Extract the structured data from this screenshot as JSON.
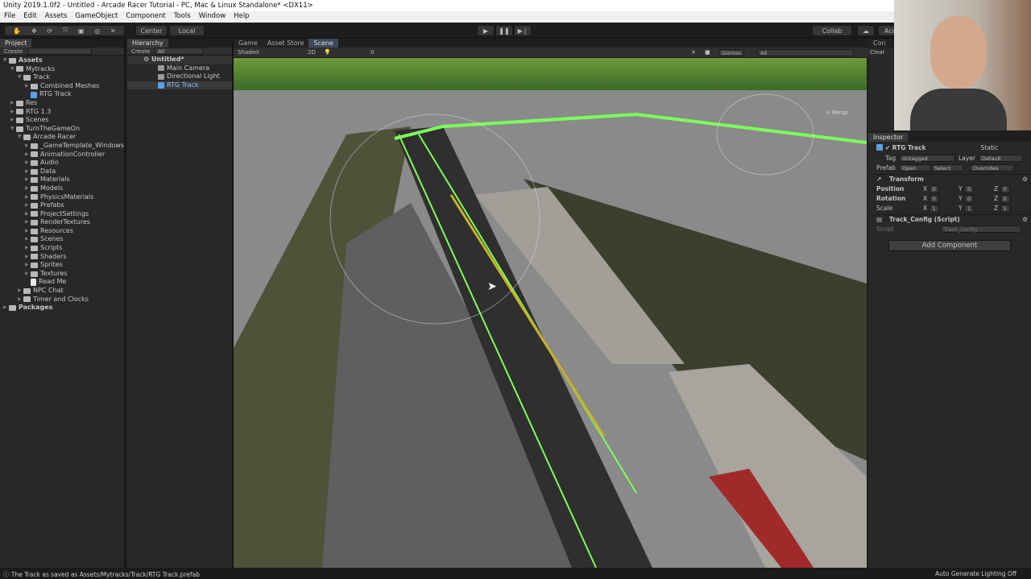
{
  "window": {
    "title": "Unity 2019.1.0f2 - Untitled - Arcade Racer Tutorial - PC, Mac & Linux Standalone* <DX11>"
  },
  "menu": [
    "File",
    "Edit",
    "Assets",
    "GameObject",
    "Component",
    "Tools",
    "Window",
    "Help"
  ],
  "toolbar": {
    "pivot": "Center",
    "space": "Local",
    "collab": "Collab",
    "account": "Acc"
  },
  "project": {
    "tab": "Project",
    "create": "Create",
    "items": [
      {
        "label": "Assets",
        "depth": 0,
        "type": "folder",
        "open": true,
        "bold": true
      },
      {
        "label": "Mytracks",
        "depth": 1,
        "type": "folder",
        "open": true
      },
      {
        "label": "Track",
        "depth": 2,
        "type": "folder",
        "open": true
      },
      {
        "label": "Combined Meshes",
        "depth": 3,
        "type": "folder",
        "open": false
      },
      {
        "label": "RTG Track",
        "depth": 3,
        "type": "prefab"
      },
      {
        "label": "Res",
        "depth": 1,
        "type": "folder",
        "open": false
      },
      {
        "label": "RTG 1.3",
        "depth": 1,
        "type": "folder",
        "open": false
      },
      {
        "label": "Scenes",
        "depth": 1,
        "type": "folder",
        "open": false
      },
      {
        "label": "TurnTheGameOn",
        "depth": 1,
        "type": "folder",
        "open": true
      },
      {
        "label": "Arcade Racer",
        "depth": 2,
        "type": "folder",
        "open": true
      },
      {
        "label": "_GameTemplate_Windows",
        "depth": 3,
        "type": "folder",
        "open": false
      },
      {
        "label": "AnimationController",
        "depth": 3,
        "type": "folder",
        "open": false
      },
      {
        "label": "Audio",
        "depth": 3,
        "type": "folder",
        "open": false
      },
      {
        "label": "Data",
        "depth": 3,
        "type": "folder",
        "open": false
      },
      {
        "label": "Materials",
        "depth": 3,
        "type": "folder",
        "open": false
      },
      {
        "label": "Models",
        "depth": 3,
        "type": "folder",
        "open": false
      },
      {
        "label": "PhysicsMaterials",
        "depth": 3,
        "type": "folder",
        "open": false
      },
      {
        "label": "Prefabs",
        "depth": 3,
        "type": "folder",
        "open": false
      },
      {
        "label": "ProjectSettings",
        "depth": 3,
        "type": "folder",
        "open": false
      },
      {
        "label": "RenderTextures",
        "depth": 3,
        "type": "folder",
        "open": false
      },
      {
        "label": "Resources",
        "depth": 3,
        "type": "folder",
        "open": false
      },
      {
        "label": "Scenes",
        "depth": 3,
        "type": "folder",
        "open": false
      },
      {
        "label": "Scripts",
        "depth": 3,
        "type": "folder",
        "open": false
      },
      {
        "label": "Shaders",
        "depth": 3,
        "type": "folder",
        "open": false
      },
      {
        "label": "Sprites",
        "depth": 3,
        "type": "folder",
        "open": false
      },
      {
        "label": "Textures",
        "depth": 3,
        "type": "folder",
        "open": false
      },
      {
        "label": "Read Me",
        "depth": 3,
        "type": "file"
      },
      {
        "label": "NPC Chat",
        "depth": 2,
        "type": "folder",
        "open": false
      },
      {
        "label": "Timer and Clocks",
        "depth": 2,
        "type": "folder",
        "open": false
      },
      {
        "label": "Packages",
        "depth": 0,
        "type": "folder",
        "open": false,
        "bold": true
      }
    ]
  },
  "hierarchy": {
    "tab": "Hierarchy",
    "create": "Create",
    "search": "All",
    "scene": "Untitled*",
    "items": [
      "Main Camera",
      "Directional Light",
      "RTG Track"
    ]
  },
  "scene_tabs": {
    "game": "Game",
    "asset_store": "Asset Store",
    "scene": "Scene",
    "shading": "Shaded",
    "mode2d": "2D",
    "gizmos": "Gizmos",
    "search": "All",
    "persp": "< Persp",
    "effects": "0"
  },
  "console": {
    "tab": "Con",
    "clear": "Clear"
  },
  "inspector": {
    "tab": "Inspector",
    "object": "RTG Track",
    "static": "Static",
    "tag_label": "Tag",
    "tag": "Untagged",
    "layer_label": "Layer",
    "layer": "Default",
    "prefab_label": "Prefab",
    "open": "Open",
    "select": "Select",
    "overrides": "Overrides",
    "transform": "Transform",
    "rows": [
      {
        "label": "Position",
        "x": "0",
        "y": "0",
        "z": "0"
      },
      {
        "label": "Rotation",
        "x": "0",
        "y": "0",
        "z": "0"
      },
      {
        "label": "Scale",
        "x": "1",
        "y": "1",
        "z": "1"
      }
    ],
    "script_component": "Track_Config (Script)",
    "script_label": "Script",
    "script_value": "Track_Config",
    "add_component": "Add Component"
  },
  "status": {
    "message": "The Track as saved as Assets/Mytracks/Track/RTG Track.prefab",
    "lighting": "Auto Generate Lighting Off"
  }
}
